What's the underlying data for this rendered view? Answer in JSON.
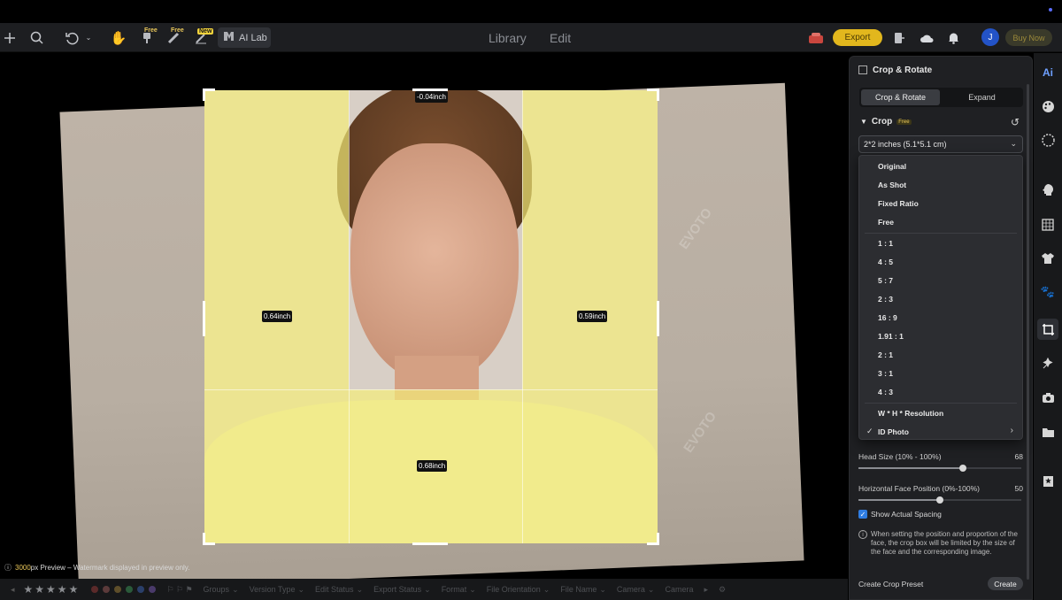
{
  "toolbar": {
    "badges": {
      "free1": "Free",
      "free2": "Free",
      "new": "New"
    },
    "ai_lab": "AI Lab",
    "mode_library": "Library",
    "mode_edit": "Edit",
    "export": "Export",
    "avatar_initial": "J",
    "buy_now": "Buy Now",
    "icons": [
      "plus-icon",
      "search-icon",
      "undo-icon",
      "chevron-down-icon",
      "hand-icon",
      "brush-free-icon",
      "eraser-free-icon",
      "pen-new-icon",
      "ai-lab-icon",
      "gift-icon",
      "compare-icon",
      "cloud-icon",
      "bell-icon"
    ]
  },
  "canvas": {
    "watermark": "EVOTO",
    "measurements": {
      "top": "-0.04inch",
      "left": "0.64inch",
      "right": "0.59inch",
      "bottom": "0.68inch"
    },
    "preview_px": "3000",
    "preview_rest": "px Preview – Watermark displayed in preview only."
  },
  "filterbar": {
    "colors": [
      "#5b2a2a",
      "#5b3a3a",
      "#5e4e2a",
      "#2a5a3a",
      "#2a3f6a",
      "#4a3a6a"
    ],
    "items": [
      "Groups",
      "Version Type",
      "Edit Status",
      "Export Status",
      "Format",
      "File Orientation",
      "File Name",
      "Camera",
      "Camera"
    ]
  },
  "panel": {
    "title": "Crop & Rotate",
    "tab_crop_rotate": "Crop & Rotate",
    "tab_expand": "Expand",
    "crop_label": "Crop",
    "crop_badge": "Free",
    "selected_ratio": "2*2 inches (5.1*5.1 cm)",
    "options_group1": [
      "Original",
      "As Shot",
      "Fixed Ratio",
      "Free"
    ],
    "options_group2": [
      "1 : 1",
      "4 : 5",
      "5 : 7",
      "2 : 3",
      "16 : 9",
      "1.91 : 1",
      "2 : 1",
      "3 : 1",
      "4 : 3"
    ],
    "options_group3": [
      "W * H * Resolution",
      "ID Photo"
    ],
    "checked_option": "ID Photo",
    "head_size_label": "Head Size (10% - 100%)",
    "head_size_value": "68",
    "head_size_fraction": 0.64,
    "face_pos_label": "Horizontal Face Position (0%-100%)",
    "face_pos_value": "50",
    "face_pos_fraction": 0.5,
    "show_spacing_label": "Show Actual Spacing",
    "show_spacing_checked": true,
    "info_text": "When setting the position and proportion of the face, the crop box will be limited by the size of the face and the corresponding image.",
    "preset_label": "Create Crop Preset",
    "create_button": "Create"
  },
  "sidebar": {
    "icons": [
      "ai-icon",
      "palette-icon",
      "texture-icon",
      "head-icon",
      "grid-icon",
      "shirt-icon",
      "paw-icon",
      "crop-rotate-icon",
      "retouch-icon",
      "camera-icon",
      "folder-icon",
      "bookmark-star-icon"
    ],
    "ai_label": "Ai"
  },
  "colors": {
    "accent": "#e2b71d",
    "checkbox": "#2f7de2",
    "overlay": "#f5ee78"
  }
}
